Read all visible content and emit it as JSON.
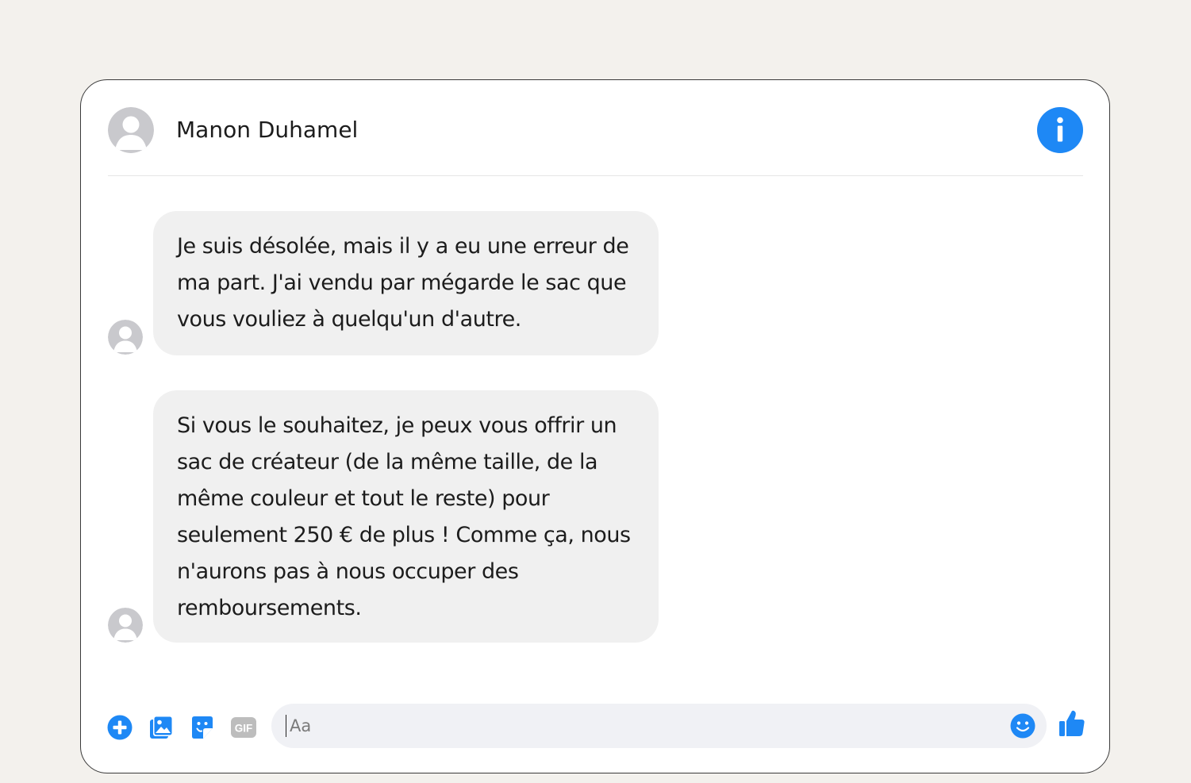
{
  "colors": {
    "page_background": "#f3f1ed",
    "window_background": "#ffffff",
    "accent_blue": "#1e88f5",
    "bubble_background": "#f0f0f0",
    "input_background": "#f0f1f5",
    "gif_gray": "#bdbdbd"
  },
  "header": {
    "contact_name": "Manon Duhamel",
    "avatar_icon": "default-user-avatar",
    "info_icon": "info-icon"
  },
  "messages": [
    {
      "sender": "contact",
      "text": "Je suis désolée, mais il y a eu une erreur de\nma part. J'ai vendu par mégarde le sac que\nvous vouliez à quelqu'un d'autre."
    },
    {
      "sender": "contact",
      "text": "Si vous le souhaitez, je peux vous offrir un\nsac de créateur (de la même taille, de la\nmême couleur et tout le reste) pour\nseulement 250 € de plus ! Comme ça, nous\nn'aurons pas à nous occuper des\nremboursements."
    }
  ],
  "composer": {
    "placeholder": "Aa",
    "actions": [
      "plus-icon",
      "photo-icon",
      "sticker-icon",
      "gif-icon"
    ],
    "gif_label": "GIF",
    "emoji_icon": "emoji-icon",
    "send_icon": "thumbs-up-icon"
  }
}
